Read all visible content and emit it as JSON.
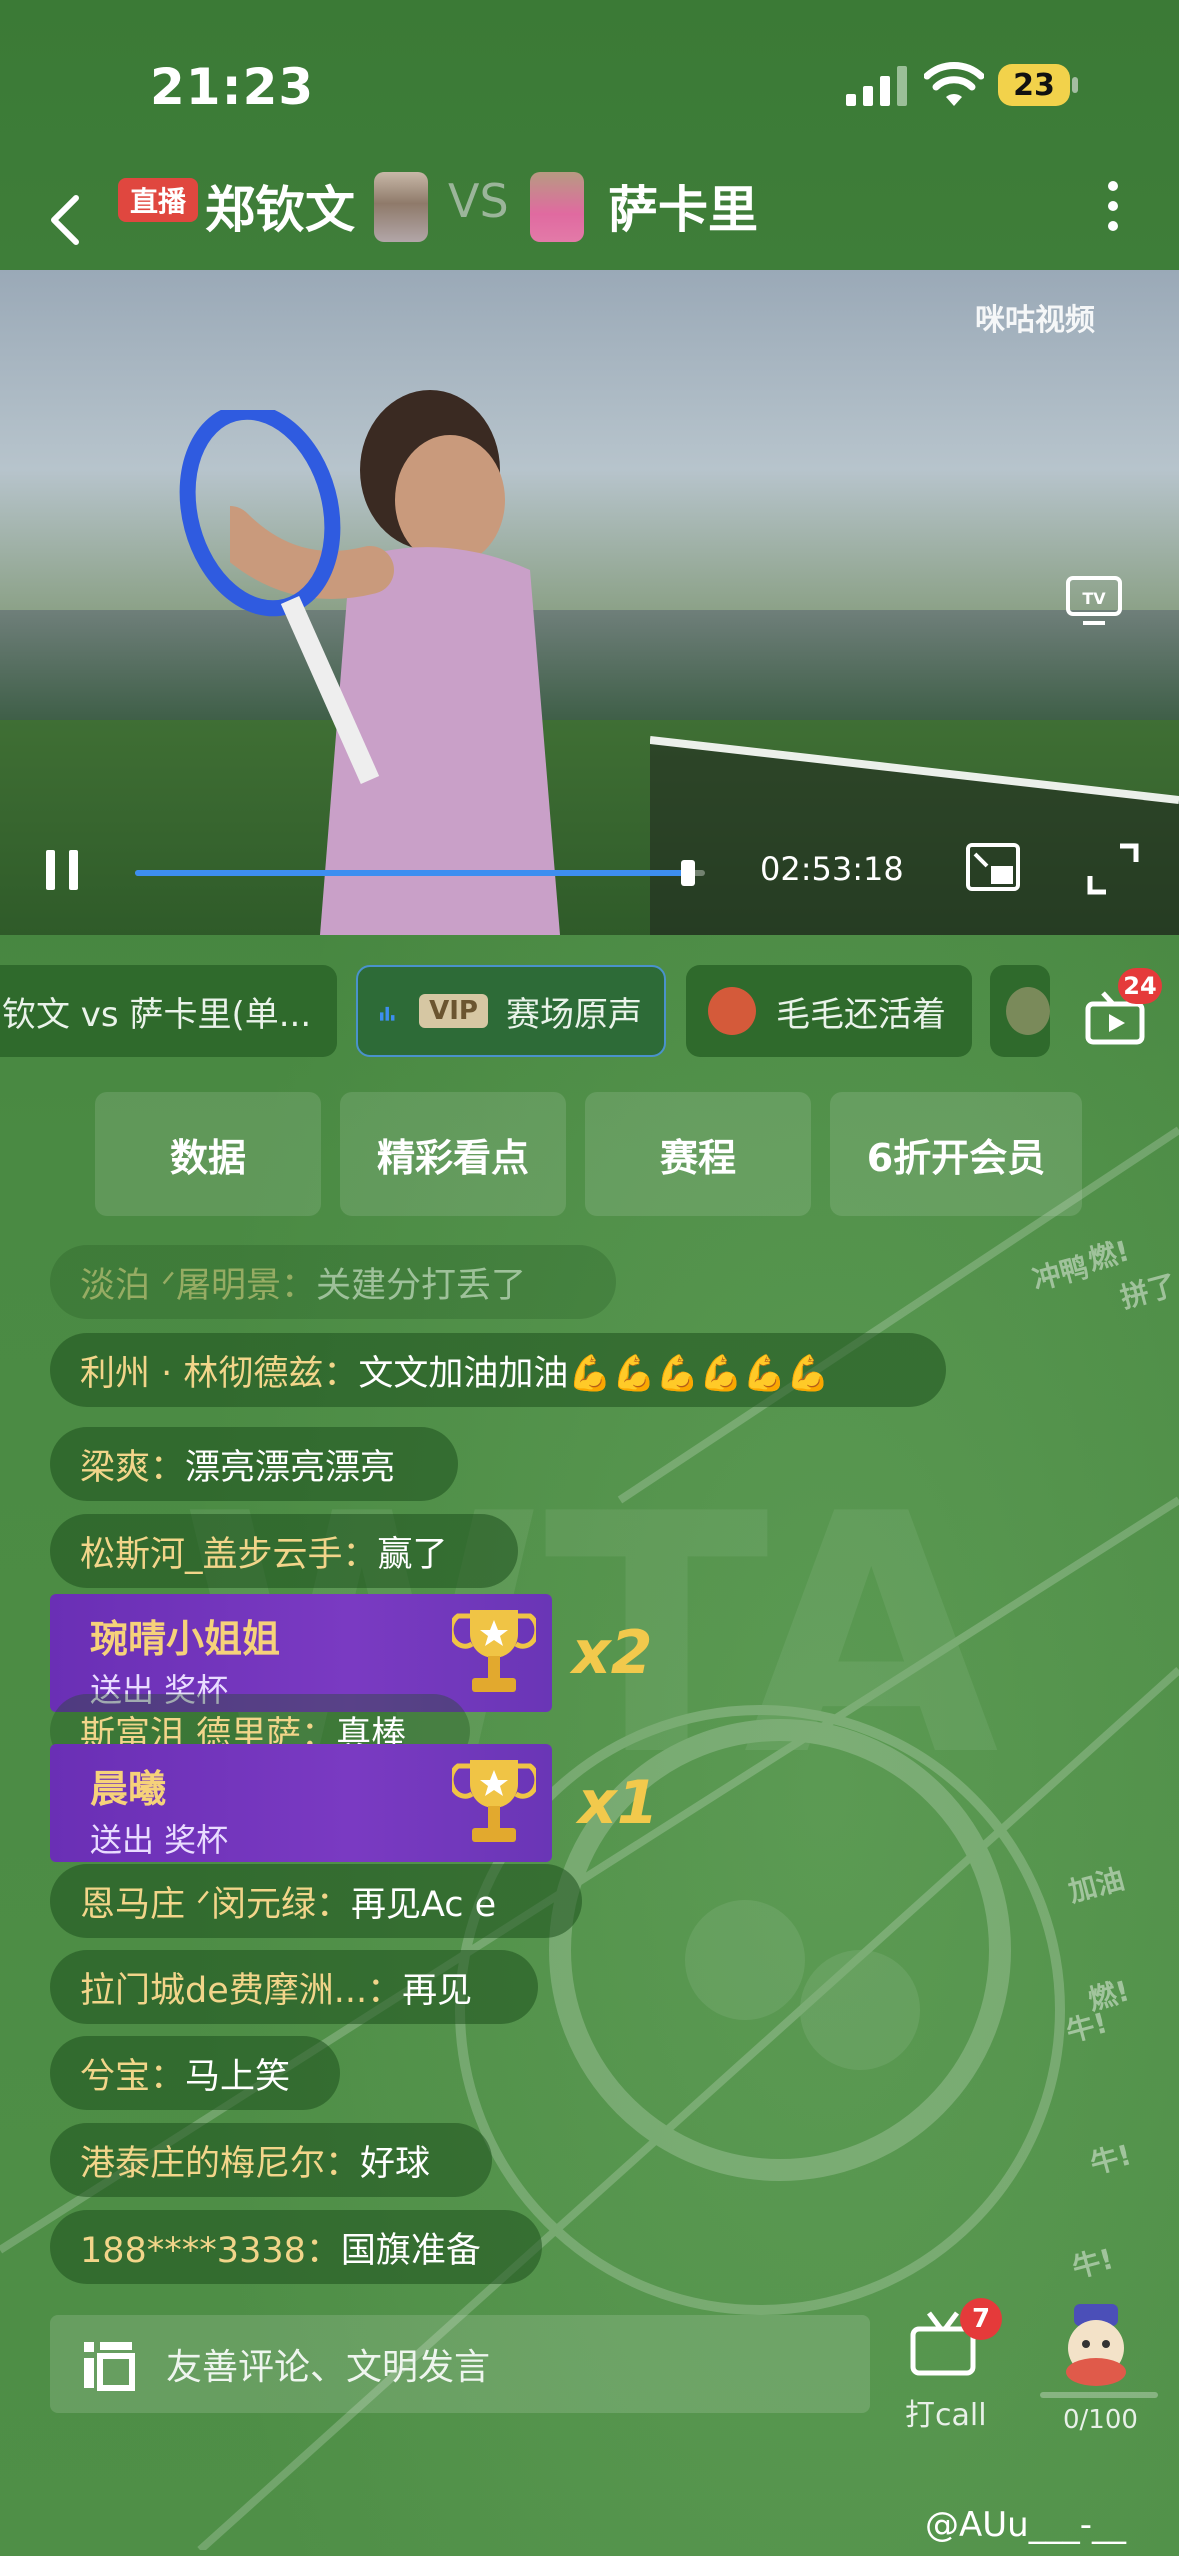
{
  "status_bar": {
    "time": "21:23",
    "battery": "23"
  },
  "header": {
    "live_badge": "直播",
    "player1": "郑钦文",
    "vs": "VS",
    "player2": "萨卡里"
  },
  "video": {
    "watermark": "咪咕视频",
    "elapsed": "02:53:18",
    "progress": 0.97
  },
  "channels": [
    {
      "label": "钦文 vs 萨卡里(单..."
    },
    {
      "vip": "VIP",
      "label": "赛场原声",
      "active": true
    },
    {
      "label": "毛毛还活着"
    }
  ],
  "playlist_badge": "24",
  "quick_buttons": [
    "数据",
    "精彩看点",
    "赛程",
    "6折开会员"
  ],
  "comments": [
    {
      "user": "淡泊 ᐟ屠明景：",
      "msg": "关建分打丢了",
      "faded": true
    },
    {
      "user": "利州 · 林彻德兹：",
      "msg": "文文加油加油💪💪💪💪💪💪"
    },
    {
      "user": "梁爽：",
      "msg": "漂亮漂亮漂亮"
    },
    {
      "user": "松斯河_盖步云手：",
      "msg": "赢了"
    },
    {
      "user": "斯富沮 德里萨：",
      "msg": "真棒"
    },
    {
      "user": "恩马庄 ᐟ闵元绿：",
      "msg": "再见Ac e"
    },
    {
      "user": "拉门城de费摩洲...：",
      "msg": "再见"
    },
    {
      "user": "兮宝：",
      "msg": "马上笑"
    },
    {
      "user": "港泰庄的梅尼尔：",
      "msg": "好球"
    },
    {
      "user": "188****3338：",
      "msg": "国旗准备"
    }
  ],
  "gifts": [
    {
      "user": "琬晴小姐姐",
      "action": "送出 奖杯",
      "count": "x2"
    },
    {
      "user": "晨曦",
      "action": "送出 奖杯",
      "count": "x1"
    }
  ],
  "bottom": {
    "input_placeholder": "友善评论、文明发言",
    "call_label": "打call",
    "call_badge": "7",
    "cheer_count": "0/100",
    "credit": "@AUu___-__"
  },
  "floating": [
    "冲鸭",
    "燃!",
    "拼了",
    "加油",
    "燃!",
    "牛!",
    "牛!",
    "牛!"
  ]
}
